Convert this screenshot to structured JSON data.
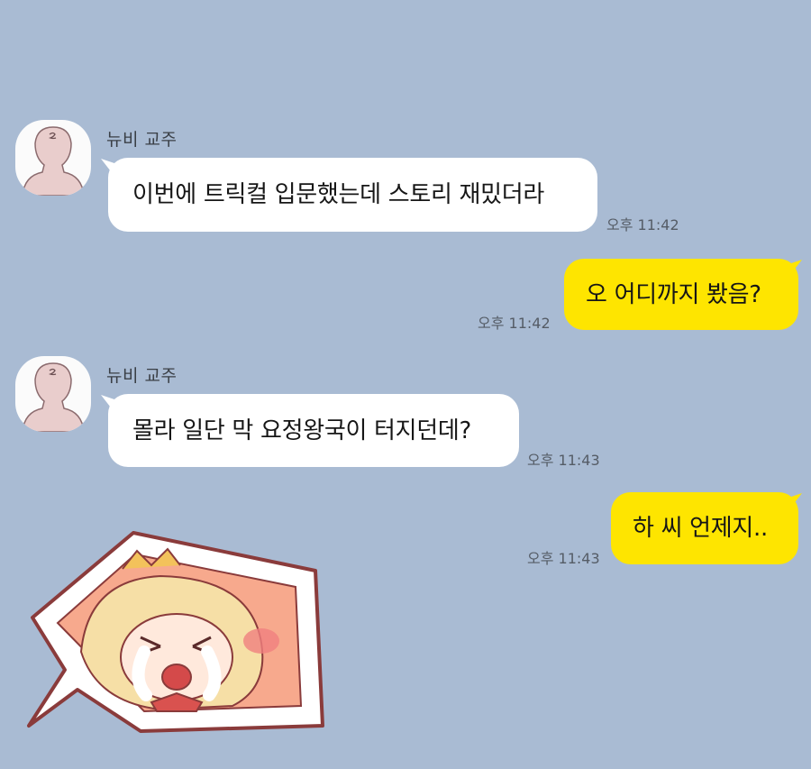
{
  "messages": [
    {
      "direction": "incoming",
      "sender": "뉴비 교주",
      "text": "이번에 트릭컬 입문했는데 스토리 재밌더라",
      "time": "오후 11:42"
    },
    {
      "direction": "outgoing",
      "text": "오 어디까지 봤음?",
      "time": "오후 11:42"
    },
    {
      "direction": "incoming",
      "sender": "뉴비 교주",
      "text": "몰라 일단 막 요정왕국이 터지던데?",
      "time": "오후 11:43"
    },
    {
      "direction": "outgoing",
      "text": "하 씨 언제지..",
      "time": "오후 11:43"
    }
  ],
  "sticker": {
    "icon": "crying-character-sticker"
  },
  "colors": {
    "background": "#a9bbd3",
    "incoming_bubble": "#ffffff",
    "outgoing_bubble": "#fee500"
  }
}
